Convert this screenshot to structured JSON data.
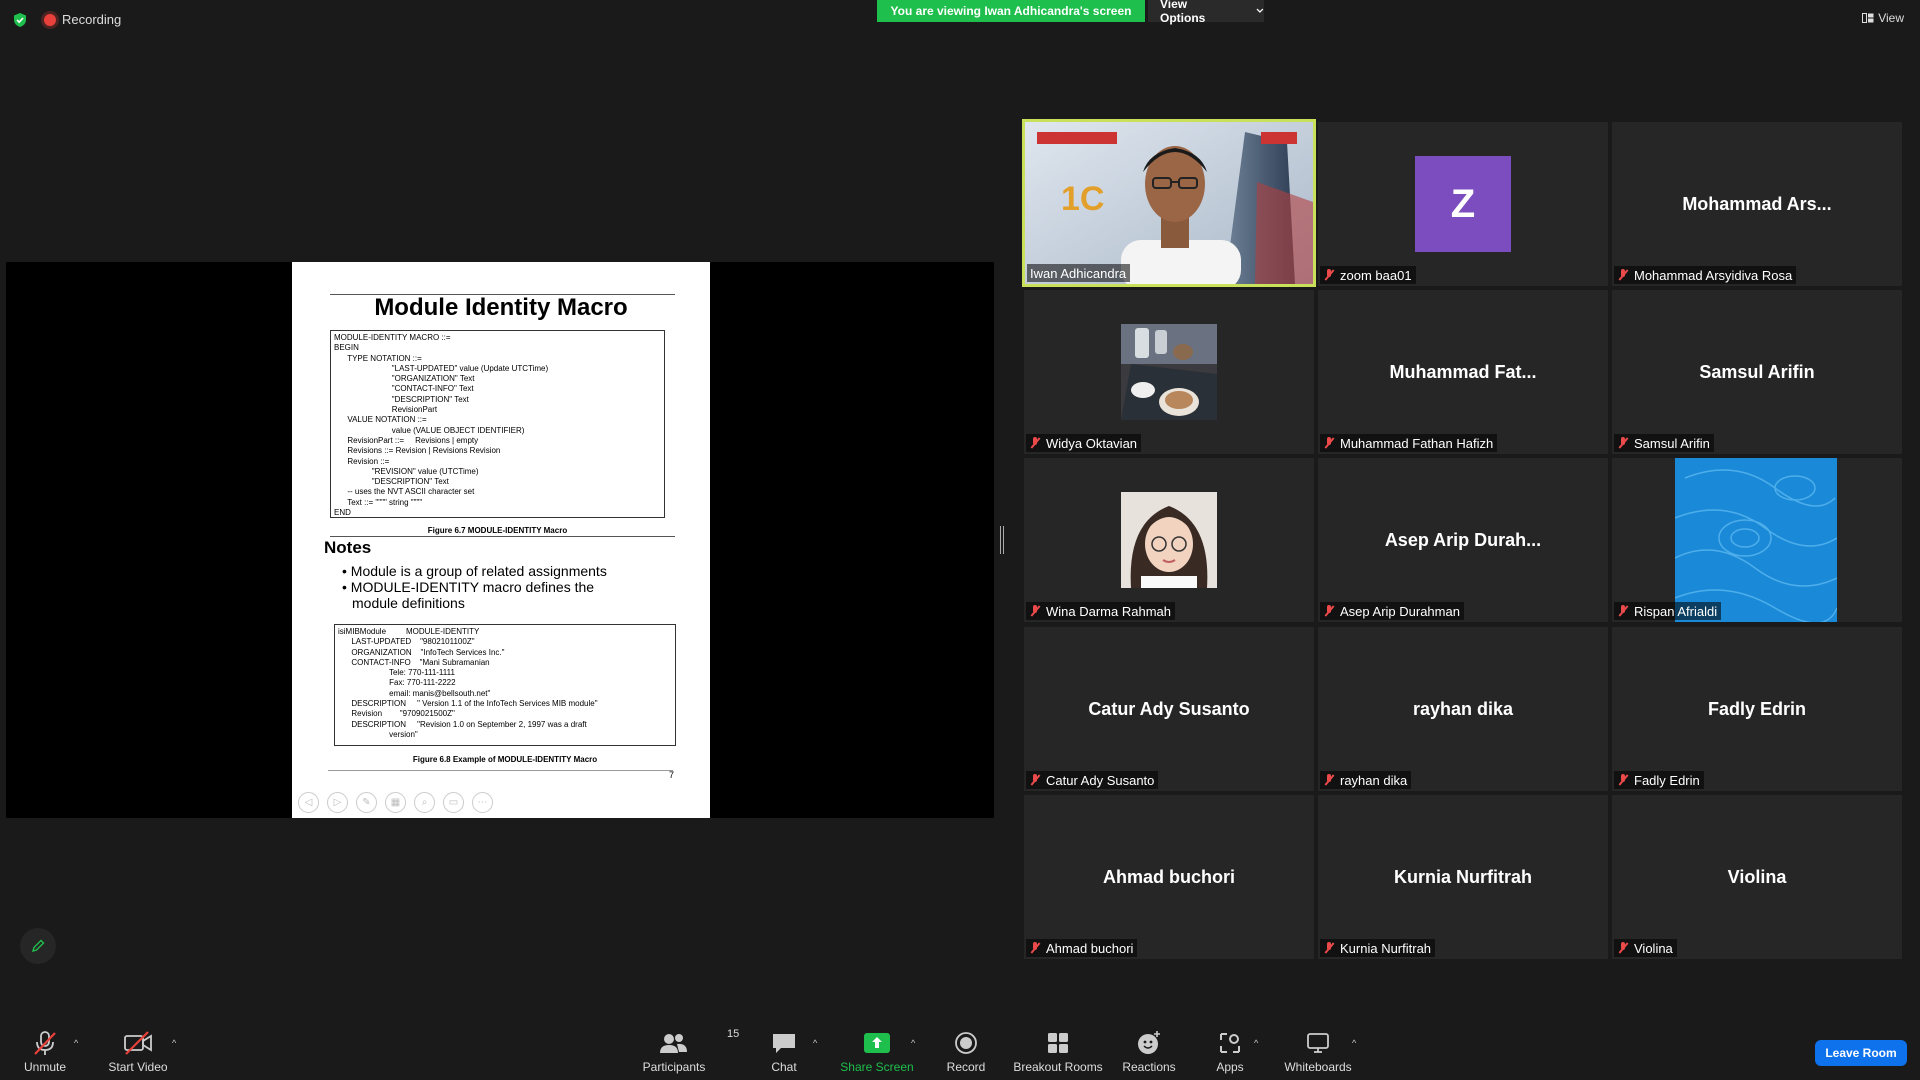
{
  "topbar": {
    "recording": "Recording",
    "viewing_banner": "You are viewing Iwan Adhicandra's screen",
    "view_options": "View Options",
    "view": "View"
  },
  "slide": {
    "title": "Module Identity Macro",
    "code1": "MODULE-IDENTITY MACRO ::=\nBEGIN\n      TYPE NOTATION ::=\n                          \"LAST-UPDATED\" value (Update UTCTime)\n                          \"ORGANIZATION\" Text\n                          \"CONTACT-INFO\" Text\n                          \"DESCRIPTION\" Text\n                          RevisionPart\n      VALUE NOTATION ::=\n                          value (VALUE OBJECT IDENTIFIER)\n      RevisionPart ::=     Revisions | empty\n      Revisions ::= Revision | Revisions Revision\n      Revision ::=\n                 \"REVISION\" value (UTCTime)\n                 \"DESCRIPTION\" Text\n      -- uses the NVT ASCII character set\n      Text ::= \"\"\"\" string \"\"\"\"\nEND",
    "caption1": "Figure 6.7  MODULE-IDENTITY Macro",
    "notes_heading": "Notes",
    "bullet1": "• Module is a group of related assignments",
    "bullet2": "• MODULE-IDENTITY macro defines the",
    "bullet2b": "module definitions",
    "code2": "isiMIBModule         MODULE-IDENTITY\n      LAST-UPDATED    \"9802101100Z\"\n      ORGANIZATION    \"InfoTech Services Inc.\"\n      CONTACT-INFO    \"Mani Subramanian\n                       Tele: 770-111-1111\n                       Fax: 770-111-2222\n                       email: manis@bellsouth.net\"\n      DESCRIPTION     \" Version 1.1 of the InfoTech Services MIB module\"\n      Revision        \"9709021500Z\"\n      DESCRIPTION     \"Revision 1.0 on September 2, 1997 was a draft\n                       version\"",
    "caption2": "Figure 6.8  Example of MODULE-IDENTITY Macro",
    "page_number": "7"
  },
  "participants": [
    {
      "label": "Iwan Adhicandra",
      "display": "",
      "type": "video",
      "active": true
    },
    {
      "label": "zoom baa01",
      "display": "Z",
      "type": "letter",
      "color": "#7c4dbe"
    },
    {
      "label": "Mohammad Arsyidiva Rosa",
      "display": "Mohammad  Ars..."
    },
    {
      "label": "Widya Oktavian",
      "display": "",
      "type": "photo-coffee"
    },
    {
      "label": "Muhammad Fathan Hafizh",
      "display": "Muhammad  Fat..."
    },
    {
      "label": "Samsul Arifin",
      "display": "Samsul Arifin"
    },
    {
      "label": "Wina Darma Rahmah",
      "display": "",
      "type": "photo-person"
    },
    {
      "label": "Asep Arip Durahman",
      "display": "Asep  Arip  Durah..."
    },
    {
      "label": "Rispan Afrialdi",
      "display": "",
      "type": "photo-blue"
    },
    {
      "label": "Catur Ady Susanto",
      "display": "Catur Ady Susanto"
    },
    {
      "label": "rayhan dika",
      "display": "rayhan dika"
    },
    {
      "label": "Fadly Edrin",
      "display": "Fadly Edrin"
    },
    {
      "label": "Ahmad buchori",
      "display": "Ahmad buchori"
    },
    {
      "label": "Kurnia Nurfitrah",
      "display": "Kurnia Nurfitrah"
    },
    {
      "label": "Violina",
      "display": "Violina"
    }
  ],
  "toolbar": {
    "unmute": "Unmute",
    "start_video": "Start Video",
    "participants": "Participants",
    "participants_count": "15",
    "chat": "Chat",
    "share_screen": "Share Screen",
    "record": "Record",
    "breakout_rooms": "Breakout Rooms",
    "reactions": "Reactions",
    "apps": "Apps",
    "whiteboards": "Whiteboards",
    "leave_room": "Leave Room"
  },
  "colors": {
    "green_banner": "#1fbf4d",
    "active_border": "#c9e05a",
    "leave": "#0e72ed",
    "share_green": "#1fbf4d"
  }
}
